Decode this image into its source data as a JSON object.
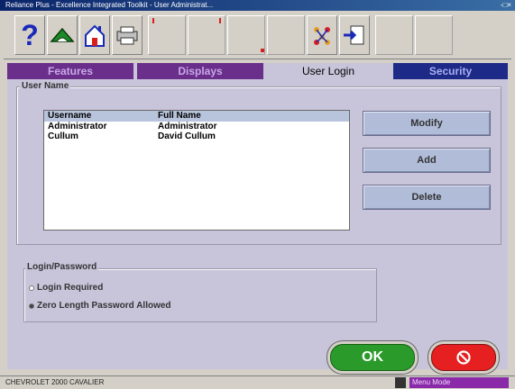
{
  "window": {
    "title": "Reliance Plus - Excellence Integrated Toolkit - User Administrat...",
    "controls": "-□×"
  },
  "tabs": [
    {
      "label": "Features",
      "style": "purple"
    },
    {
      "label": "Displays",
      "style": "purple"
    },
    {
      "label": "User Login",
      "style": "active"
    },
    {
      "label": "Security",
      "style": "navy"
    }
  ],
  "user_name": {
    "group_label": "User Name",
    "columns": [
      "Username",
      "Full Name"
    ],
    "rows": [
      [
        "Administrator",
        "Administrator"
      ],
      [
        "Cullum",
        "David Cullum"
      ]
    ]
  },
  "buttons": {
    "modify": "Modify",
    "add": "Add",
    "delete": "Delete"
  },
  "login_password": {
    "group_label": "Login/Password",
    "options": [
      {
        "label": "Login Required",
        "checked": false
      },
      {
        "label": "Zero Length Password Allowed",
        "checked": true
      }
    ]
  },
  "ok_label": "OK",
  "status": {
    "vehicle": "CHEVROLET 2000 CAVALIER",
    "mode": "Menu Mode"
  },
  "icons": [
    "help-icon",
    "alignment-icon",
    "home-icon",
    "printer-icon",
    "flowchart-icon",
    "export-icon"
  ]
}
